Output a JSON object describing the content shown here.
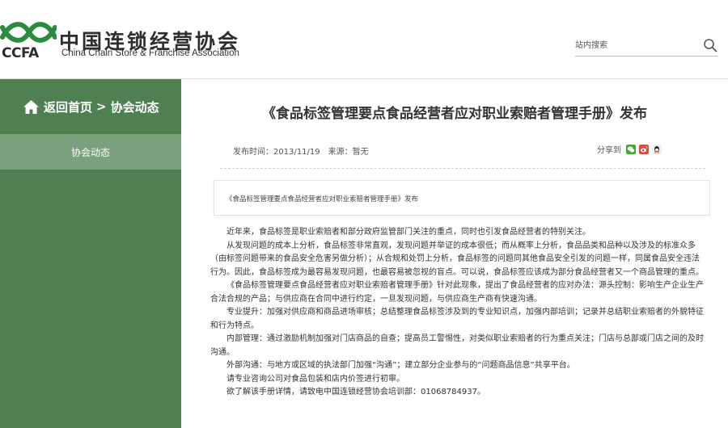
{
  "header": {
    "logo": {
      "cn_name": "中国连锁经营协会",
      "abbr": "CCFA",
      "en_name": "China Chain Store & Franchise Association"
    },
    "search": {
      "placeholder": "站内搜索",
      "icon": "search-icon"
    }
  },
  "sidebar": {
    "home_label": "返回首页",
    "separator": ">",
    "section_label": "协会动态",
    "items": [
      {
        "label": "协会动态",
        "active": true
      }
    ],
    "colors": {
      "background": "#4e8052",
      "active_item": "#7ba07d"
    }
  },
  "article": {
    "title": "《食品标签管理要点食品经营者应对职业索赔者管理手册》发布",
    "publish_label": "发布时间：",
    "publish_date": "2013/11/19",
    "source_label": "来源：",
    "source": "暂无",
    "share_label": "分享到",
    "share_icons": [
      "wechat-icon",
      "weibo-icon",
      "qq-icon"
    ],
    "summary": "《食品标签管理要点食品经营者应对职业索赔者管理手册》发布",
    "paragraphs": [
      "近年来，食品标签是职业索赔者和部分政府监管部门关注的重点，同时也引发食品经营者的特别关注。",
      "从发现问题的成本上分析，食品标签非常直观，发现问题并举证的成本很低；而从概率上分析，食品品类和品种以及涉及的标准众多（由标签问题带来的食品安全危害另做分析）；从合规和处罚上分析，食品标签的问题同其他食品安全引发的问题一样，同属食品安全违法行为。因此，食品标签成为最容易发现问题，也最容易被忽视的盲点。可以说，食品标签应该成为部分食品经营者又一个商品管理的重点。",
      "《食品标签管理要点食品经营者应对职业索赔者管理手册》针对此现象，提出了食品经营者的应对办法：源头控制：影响生产企业生产合法合规的产品；与供应商在合同中进行约定，一旦发现问题，与供应商生产商有快速沟通。",
      "专业提升：加强对供应商和商品进场审核；总结整理食品标签涉及到的专业知识点，加强内部培训；记录并总结职业索赔者的外貌特征和行为特点。",
      "内部管理：通过激励机制加强对门店商品的自查；提高员工警惕性，对类似职业索赔者的行为重点关注；门店与总部或门店之间的及时沟通。",
      "外部沟通：与地方或区域的执法部门加强“沟通”；建立部分企业参与的“问题商品信息”共享平台。",
      "请专业咨询公司对食品包装和店内价签进行初审。",
      "欲了解该手册详情，请致电中国连锁经营协会培训部：01068784937。"
    ]
  }
}
